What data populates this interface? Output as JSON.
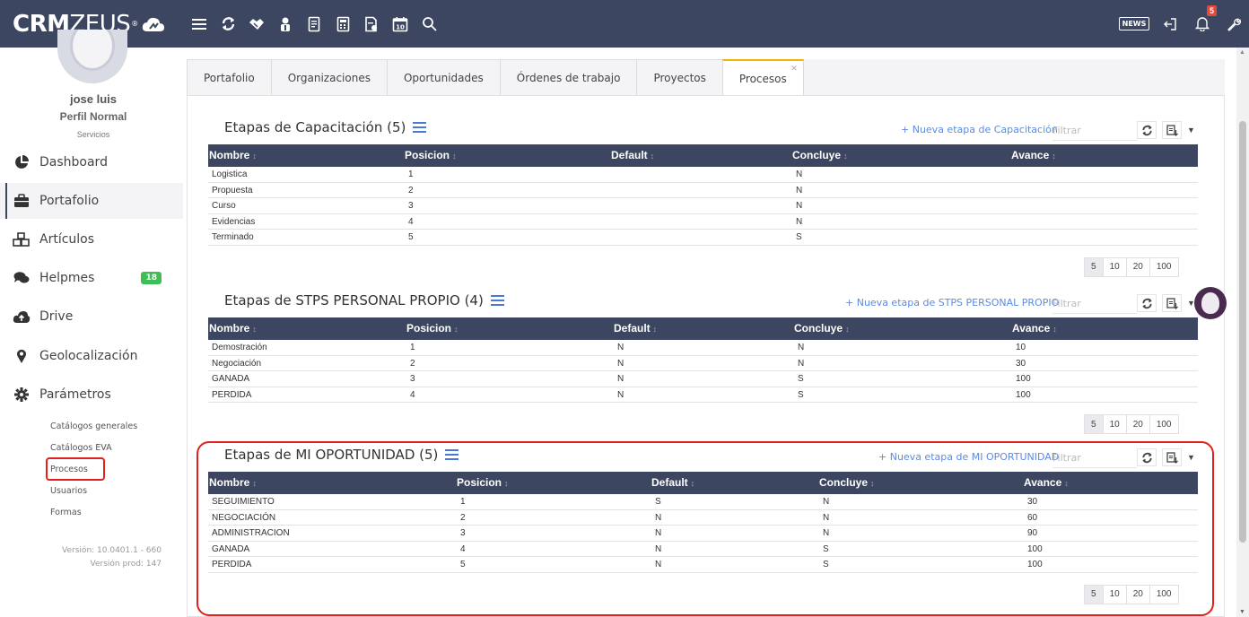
{
  "app": {
    "logo_bold": "CRM",
    "logo_light": "ZEUS",
    "logo_reg": "®"
  },
  "topbar": {
    "icons": [
      "menu-icon",
      "refresh-icon",
      "handshake-icon",
      "contacts-icon",
      "report-icon",
      "calculator-icon",
      "document-icon",
      "calendar-icon",
      "search-icon"
    ],
    "calendar_day": "10",
    "news_label": "NEWS",
    "notifications_count": "5"
  },
  "sidebar": {
    "user_name": "jose luis",
    "user_profile": "Perfil Normal",
    "user_dept": "Servicios",
    "items": [
      {
        "label": "Dashboard",
        "icon": "pie-chart-icon"
      },
      {
        "label": "Portafolio",
        "icon": "briefcase-icon"
      },
      {
        "label": "Artículos",
        "icon": "cubes-icon"
      },
      {
        "label": "Helpmes",
        "icon": "comments-icon",
        "badge": "18"
      },
      {
        "label": "Drive",
        "icon": "cloud-upload-icon"
      },
      {
        "label": "Geolocalización",
        "icon": "map-marker-icon"
      },
      {
        "label": "Parámetros",
        "icon": "gear-icon"
      }
    ],
    "subitems": [
      "Catálogos generales",
      "Catálogos EVA",
      "Procesos",
      "Usuarios",
      "Formas"
    ],
    "version": "Versión: 10.0401.1 - 660",
    "version_prod": "Versión prod: 147"
  },
  "tabs": [
    "Portafolio",
    "Organizaciones",
    "Oportunidades",
    "Órdenes de trabajo",
    "Proyectos",
    "Procesos"
  ],
  "columns": [
    "Nombre",
    "Posicion",
    "Default",
    "Concluye",
    "Avance"
  ],
  "pager": [
    "5",
    "10",
    "20",
    "100"
  ],
  "filter_placeholder": "Filtrar",
  "sections": [
    {
      "title": "Etapas de Capacitación (5)",
      "new_link": "+ Nueva etapa de Capacitación",
      "rows": [
        [
          "Logistica",
          "1",
          "",
          "N",
          ""
        ],
        [
          "Propuesta",
          "2",
          "",
          "N",
          ""
        ],
        [
          "Curso",
          "3",
          "",
          "N",
          ""
        ],
        [
          "Evidencias",
          "4",
          "",
          "N",
          ""
        ],
        [
          "Terminado",
          "5",
          "",
          "S",
          ""
        ]
      ]
    },
    {
      "title": "Etapas de STPS PERSONAL PROPIO (4)",
      "new_link": "+ Nueva etapa de STPS PERSONAL PROPIO",
      "rows": [
        [
          "Demostración",
          "1",
          "N",
          "N",
          "10"
        ],
        [
          "Negociación",
          "2",
          "N",
          "N",
          "30"
        ],
        [
          "GANADA",
          "3",
          "N",
          "S",
          "100"
        ],
        [
          "PERDIDA",
          "4",
          "N",
          "S",
          "100"
        ]
      ]
    },
    {
      "title": "Etapas de MI OPORTUNIDAD (5)",
      "new_link": "+ Nueva etapa de MI OPORTUNIDAD",
      "rows": [
        [
          "SEGUIMIENTO",
          "1",
          "S",
          "N",
          "30"
        ],
        [
          "NEGOCIACIÓN",
          "2",
          "N",
          "N",
          "60"
        ],
        [
          "ADMINISTRACION",
          "3",
          "N",
          "N",
          "90"
        ],
        [
          "GANADA",
          "4",
          "N",
          "S",
          "100"
        ],
        [
          "PERDIDA",
          "5",
          "N",
          "S",
          "100"
        ]
      ]
    }
  ],
  "colors": {
    "header": "#3d4660",
    "highlight": "#e0201d",
    "link": "#5b8be0",
    "badge": "#3fbe56"
  }
}
